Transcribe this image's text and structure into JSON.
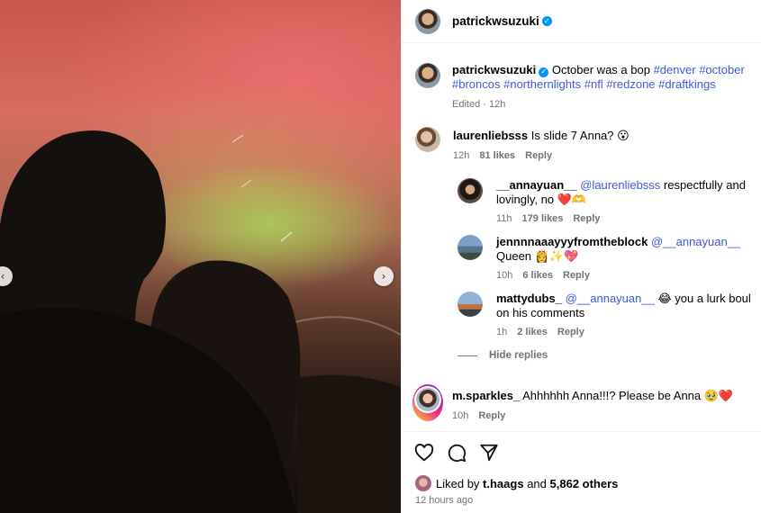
{
  "post": {
    "author": "patrickwsuzuki",
    "caption_text": "October was a bop",
    "hashtags": [
      "#denver",
      "#october",
      "#broncos",
      "#northernlights",
      "#nfl",
      "#redzone",
      "#draftkings"
    ],
    "edited_label": "Edited",
    "edited_time": "12h"
  },
  "comments": [
    {
      "user": "laurenliebsss",
      "text": "Is slide 7 Anna? 😮",
      "time": "12h",
      "likes": "81 likes",
      "reply": "Reply"
    },
    {
      "user": "__annayuan__",
      "mention": "@laurenliebsss",
      "text": " respectfully and lovingly, no ❤️🫶",
      "time": "11h",
      "likes": "179 likes",
      "reply": "Reply"
    },
    {
      "user": "jennnnaaayyyfromtheblock",
      "mention": "@__annayuan__",
      "text": " Queen 👸✨💖",
      "time": "10h",
      "likes": "6 likes",
      "reply": "Reply"
    },
    {
      "user": "mattydubs_",
      "mention": "@__annayuan__",
      "text": " 😂 you a lurk boul on his comments",
      "time": "1h",
      "likes": "2 likes",
      "reply": "Reply"
    },
    {
      "user": "m.sparkles_",
      "text": "Ahhhhhh Anna!!!? Please be Anna 🥹❤️",
      "time": "10h",
      "reply": "Reply"
    }
  ],
  "hide_replies": "Hide replies",
  "footer": {
    "liked_by_prefix": "Liked by",
    "liked_by_user": "t.haags",
    "and": "and",
    "others": "5,862 others",
    "posted": "12 hours ago"
  },
  "icons": [
    "heart-icon",
    "comment-icon",
    "share-icon",
    "verified-icon",
    "chevron-right-icon",
    "chevron-left-icon"
  ]
}
